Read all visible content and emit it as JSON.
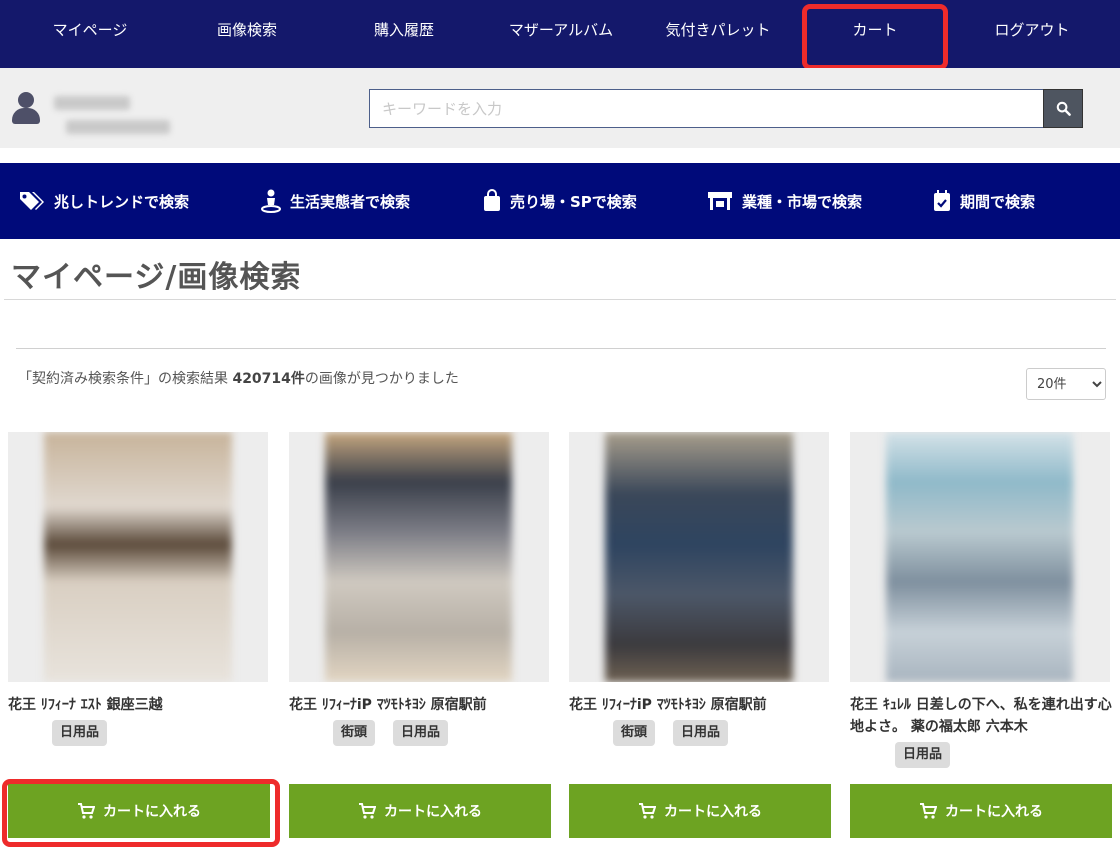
{
  "topnav": {
    "items": [
      "マイページ",
      "画像検索",
      "購入履歴",
      "マザーアルバム",
      "気付きパレット",
      "カート",
      "ログアウト"
    ]
  },
  "search": {
    "placeholder": "キーワードを入力"
  },
  "catnav": {
    "items": [
      {
        "label": "兆しトレンドで検索",
        "icon": "tags-icon"
      },
      {
        "label": "生活実態者で検索",
        "icon": "person-icon"
      },
      {
        "label": "売り場・SPで検索",
        "icon": "shopping-bag-icon"
      },
      {
        "label": "業種・市場で検索",
        "icon": "store-icon"
      },
      {
        "label": "期間で検索",
        "icon": "calendar-check-icon"
      }
    ]
  },
  "page": {
    "title": "マイページ/画像検索",
    "result_prefix": "「契約済み検索条件」の検索結果 ",
    "result_count": "420714件",
    "result_suffix": "の画像が見つかりました",
    "per_page": "20件"
  },
  "cards": [
    {
      "caption": "花王 ﾘﾌｨｰﾅ ｴｽﾄ 銀座三越",
      "tags": [
        "日用品"
      ],
      "button": "カートに入れる"
    },
    {
      "caption": "花王 ﾘﾌｨｰﾅiP ﾏﾂﾓﾄｷﾖｼ 原宿駅前",
      "tags": [
        "街頭",
        "日用品"
      ],
      "button": "カートに入れる"
    },
    {
      "caption": "花王 ﾘﾌｨｰﾅiP ﾏﾂﾓﾄｷﾖｼ 原宿駅前",
      "tags": [
        "街頭",
        "日用品"
      ],
      "button": "カートに入れる"
    },
    {
      "caption": "花王 ｷｭﾚﾙ 日差しの下へ、私を連れ出す心地よさ。 薬の福太郎 六本木",
      "tags": [
        "日用品"
      ],
      "button": "カートに入れる"
    }
  ],
  "colors": {
    "topnav_bg": "#14186b",
    "catnav_bg": "#000a7a",
    "cart_button": "#6da322",
    "highlight": "#ee2b2b"
  }
}
